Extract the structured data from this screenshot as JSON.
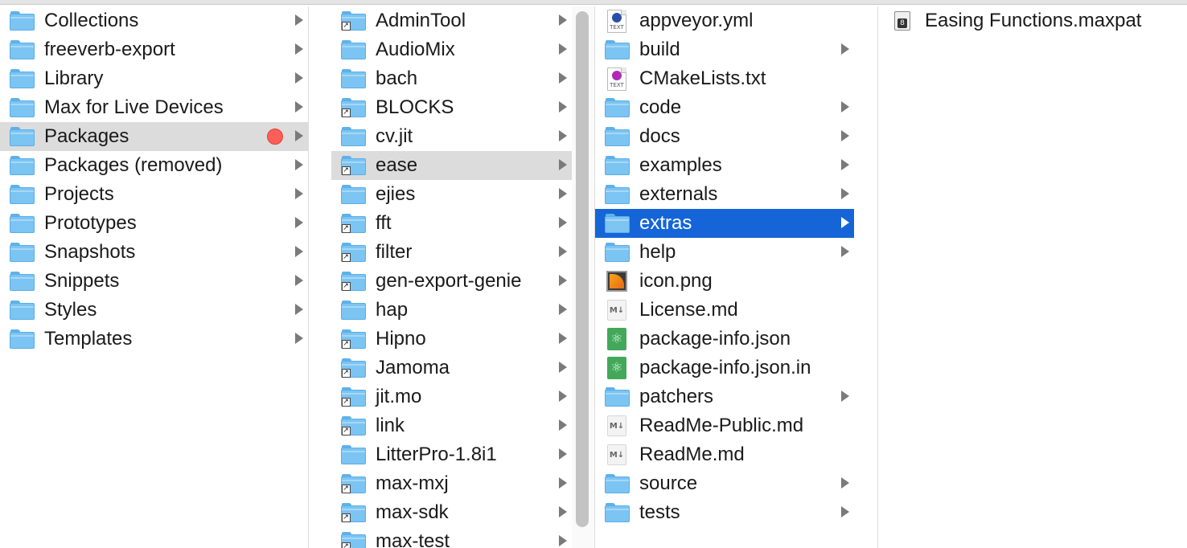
{
  "column1": [
    {
      "name": "Collections",
      "type": "folder",
      "chevron": true
    },
    {
      "name": "freeverb-export",
      "type": "folder",
      "chevron": true
    },
    {
      "name": "Library",
      "type": "folder",
      "chevron": true
    },
    {
      "name": "Max for Live Devices",
      "type": "folder",
      "chevron": true
    },
    {
      "name": "Packages",
      "type": "folder",
      "chevron": true,
      "selected": "gray",
      "tag_color": "#fb5f57"
    },
    {
      "name": "Packages (removed)",
      "type": "folder",
      "chevron": true
    },
    {
      "name": "Projects",
      "type": "folder",
      "chevron": true
    },
    {
      "name": "Prototypes",
      "type": "folder",
      "chevron": true
    },
    {
      "name": "Snapshots",
      "type": "folder",
      "chevron": true
    },
    {
      "name": "Snippets",
      "type": "folder",
      "chevron": true
    },
    {
      "name": "Styles",
      "type": "folder",
      "chevron": true
    },
    {
      "name": "Templates",
      "type": "folder",
      "chevron": true
    }
  ],
  "column2": [
    {
      "name": "AdminTool",
      "type": "alias-folder",
      "chevron": true
    },
    {
      "name": "AudioMix",
      "type": "folder",
      "chevron": true
    },
    {
      "name": "bach",
      "type": "folder",
      "chevron": true
    },
    {
      "name": "BLOCKS",
      "type": "alias-folder",
      "chevron": true
    },
    {
      "name": "cv.jit",
      "type": "folder",
      "chevron": true
    },
    {
      "name": "ease",
      "type": "alias-folder",
      "chevron": true,
      "selected": "gray"
    },
    {
      "name": "ejies",
      "type": "folder",
      "chevron": true
    },
    {
      "name": "fft",
      "type": "alias-folder",
      "chevron": true
    },
    {
      "name": "filter",
      "type": "alias-folder",
      "chevron": true
    },
    {
      "name": "gen-export-genie",
      "type": "alias-folder",
      "chevron": true
    },
    {
      "name": "hap",
      "type": "folder",
      "chevron": true
    },
    {
      "name": "Hipno",
      "type": "alias-folder",
      "chevron": true
    },
    {
      "name": "Jamoma",
      "type": "alias-folder",
      "chevron": true
    },
    {
      "name": "jit.mo",
      "type": "alias-folder",
      "chevron": true
    },
    {
      "name": "link",
      "type": "alias-folder",
      "chevron": true
    },
    {
      "name": "LitterPro-1.8i1",
      "type": "folder",
      "chevron": true
    },
    {
      "name": "max-mxj",
      "type": "alias-folder",
      "chevron": true
    },
    {
      "name": "max-sdk",
      "type": "alias-folder",
      "chevron": true
    },
    {
      "name": "max-test",
      "type": "alias-folder",
      "chevron": true
    }
  ],
  "column3": [
    {
      "name": "appveyor.yml",
      "type": "text-doc",
      "icon_color": "#2a4fa8",
      "doc_label": "TEXT",
      "chevron": false
    },
    {
      "name": "build",
      "type": "folder",
      "chevron": true
    },
    {
      "name": "CMakeLists.txt",
      "type": "text-doc",
      "icon_color": "#b02ab5",
      "doc_label": "TEXT",
      "chevron": false
    },
    {
      "name": "code",
      "type": "folder",
      "chevron": true
    },
    {
      "name": "docs",
      "type": "folder",
      "chevron": true
    },
    {
      "name": "examples",
      "type": "folder",
      "chevron": true
    },
    {
      "name": "externals",
      "type": "folder",
      "chevron": true
    },
    {
      "name": "extras",
      "type": "folder",
      "chevron": true,
      "selected": "blue"
    },
    {
      "name": "help",
      "type": "folder",
      "chevron": true
    },
    {
      "name": "icon.png",
      "type": "png",
      "chevron": false
    },
    {
      "name": "License.md",
      "type": "md",
      "doc_label": "M↓",
      "chevron": false
    },
    {
      "name": "package-info.json",
      "type": "json",
      "chevron": false
    },
    {
      "name": "package-info.json.in",
      "type": "json",
      "chevron": false
    },
    {
      "name": "patchers",
      "type": "folder",
      "chevron": true
    },
    {
      "name": "ReadMe-Public.md",
      "type": "md",
      "doc_label": "M↓",
      "chevron": false
    },
    {
      "name": "ReadMe.md",
      "type": "md",
      "doc_label": "M↓",
      "chevron": false
    },
    {
      "name": "source",
      "type": "folder",
      "chevron": true
    },
    {
      "name": "tests",
      "type": "folder",
      "chevron": true
    }
  ],
  "column4": [
    {
      "name": "Easing Functions.maxpat",
      "type": "maxpat",
      "chevron": false
    }
  ],
  "colors": {
    "selection_blue": "#1565d8",
    "selection_gray": "#dcdcdc",
    "folder_blue": "#7cc4f2"
  }
}
